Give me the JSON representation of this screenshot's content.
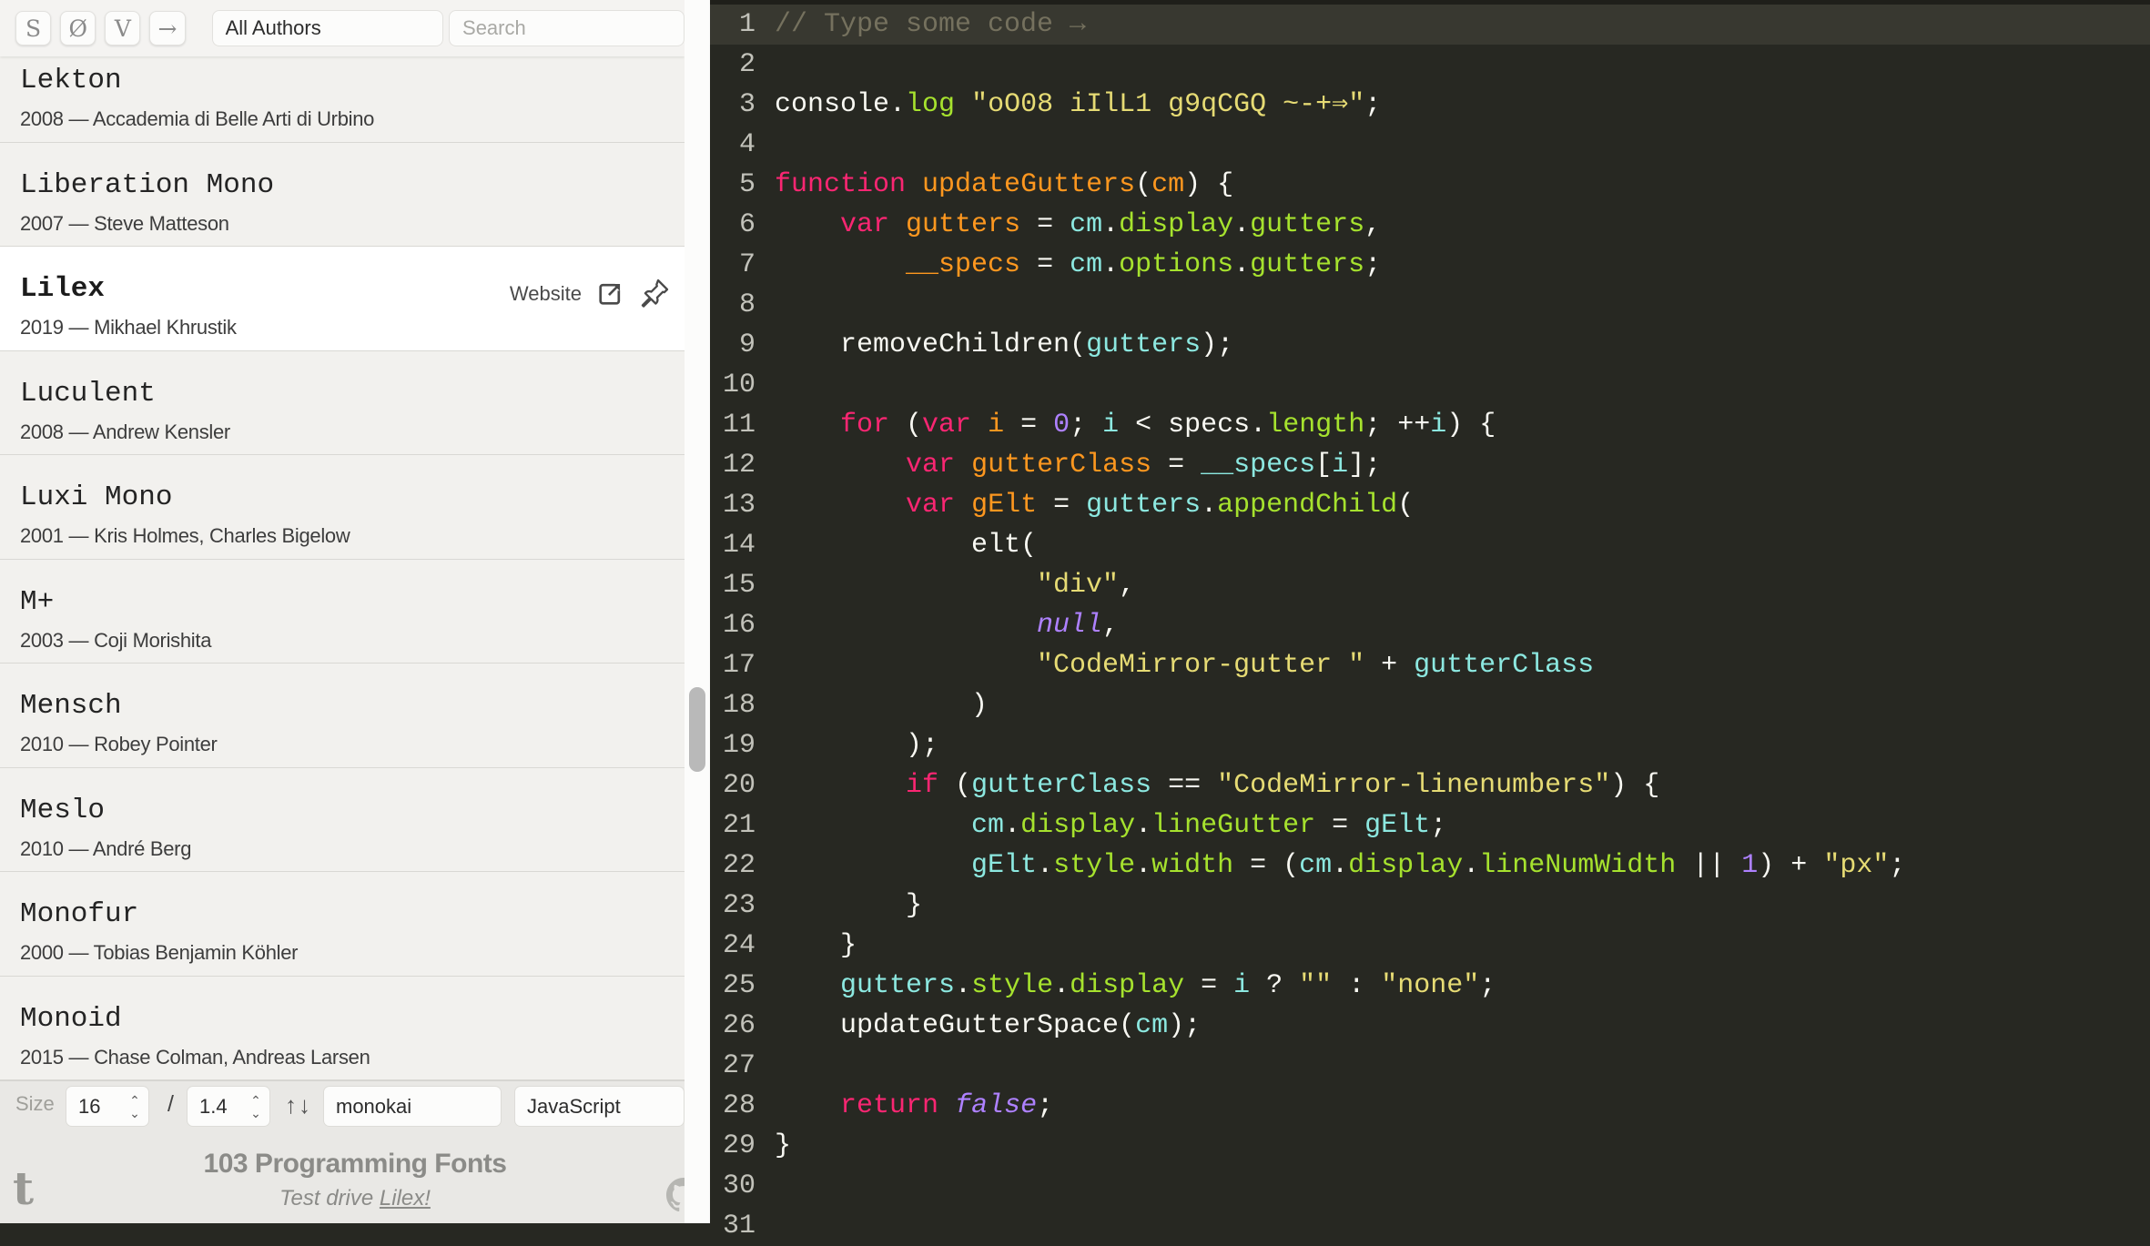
{
  "toolbar": {
    "buttons": [
      {
        "label": "S"
      },
      {
        "label": "Ø"
      },
      {
        "label": "V"
      },
      {
        "label": "→"
      }
    ],
    "author_filter": "All Authors",
    "search_placeholder": "Search"
  },
  "font_list": [
    {
      "name": "Lekton",
      "year": "2008",
      "author": "Accademia di Belle Arti di Urbino",
      "selected": false
    },
    {
      "name": "Liberation Mono",
      "year": "2007",
      "author": "Steve Matteson",
      "selected": false
    },
    {
      "name": "Lilex",
      "year": "2019",
      "author": "Mikhael Khrustik",
      "selected": true,
      "website_label": "Website"
    },
    {
      "name": "Luculent",
      "year": "2008",
      "author": "Andrew Kensler",
      "selected": false
    },
    {
      "name": "Luxi Mono",
      "year": "2001",
      "author": "Kris Holmes, Charles Bigelow",
      "selected": false
    },
    {
      "name": "M+",
      "year": "2003",
      "author": "Coji Morishita",
      "selected": false
    },
    {
      "name": "Mensch",
      "year": "2010",
      "author": "Robey Pointer",
      "selected": false
    },
    {
      "name": "Meslo",
      "year": "2010",
      "author": "André Berg",
      "selected": false
    },
    {
      "name": "Monofur",
      "year": "2000",
      "author": "Tobias Benjamin Köhler",
      "selected": false
    },
    {
      "name": "Monoid",
      "year": "2015",
      "author": "Chase Colman, Andreas Larsen",
      "selected": false
    }
  ],
  "list_separator": " — ",
  "controls": {
    "size_label": "Size",
    "size_value": "16",
    "separator": "/",
    "line_height_value": "1.4",
    "theme_up": "↑",
    "theme_down": "↓",
    "theme": "monokai",
    "language": "JavaScript"
  },
  "footer": {
    "title": "103 Programming Fonts",
    "tagline_prefix": "Test drive ",
    "tagline_link": "Lilex!"
  },
  "editor": {
    "theme_name": "monokai",
    "palette": {
      "background": "#272822",
      "active_line": "#383830",
      "gutter_text": "#c2c2ba",
      "t": "#f8f8f2",
      "c": "#75715e",
      "k": "#f92672",
      "d": "#fd971f",
      "v": "#8ce8e0",
      "p": "#a6e22e",
      "s": "#e6db74",
      "a": "#ae81ff",
      "n": "#ae81ff"
    },
    "lines": [
      {
        "n": 1,
        "active": true,
        "tokens": [
          [
            "c",
            "// Type some code →"
          ]
        ]
      },
      {
        "n": 2,
        "tokens": []
      },
      {
        "n": 3,
        "tokens": [
          [
            "t",
            "console."
          ],
          [
            "p",
            "log"
          ],
          [
            "t",
            " "
          ],
          [
            "s",
            "\"oO08 iIlL1 g9qCGQ ~-+⇒\""
          ],
          [
            "t",
            ";"
          ]
        ]
      },
      {
        "n": 4,
        "tokens": []
      },
      {
        "n": 5,
        "tokens": [
          [
            "k",
            "function"
          ],
          [
            "t",
            " "
          ],
          [
            "d",
            "updateGutters"
          ],
          [
            "t",
            "("
          ],
          [
            "d",
            "cm"
          ],
          [
            "t",
            ") {"
          ]
        ]
      },
      {
        "n": 6,
        "tokens": [
          [
            "t",
            "    "
          ],
          [
            "k",
            "var"
          ],
          [
            "t",
            " "
          ],
          [
            "d",
            "gutters"
          ],
          [
            "t",
            " = "
          ],
          [
            "v",
            "cm"
          ],
          [
            "t",
            "."
          ],
          [
            "p",
            "display"
          ],
          [
            "t",
            "."
          ],
          [
            "p",
            "gutters"
          ],
          [
            "t",
            ","
          ]
        ]
      },
      {
        "n": 7,
        "tokens": [
          [
            "t",
            "        "
          ],
          [
            "d",
            "__specs"
          ],
          [
            "t",
            " = "
          ],
          [
            "v",
            "cm"
          ],
          [
            "t",
            "."
          ],
          [
            "p",
            "options"
          ],
          [
            "t",
            "."
          ],
          [
            "p",
            "gutters"
          ],
          [
            "t",
            ";"
          ]
        ]
      },
      {
        "n": 8,
        "tokens": []
      },
      {
        "n": 9,
        "tokens": [
          [
            "t",
            "    removeChildren("
          ],
          [
            "v",
            "gutters"
          ],
          [
            "t",
            ");"
          ]
        ]
      },
      {
        "n": 10,
        "tokens": []
      },
      {
        "n": 11,
        "tokens": [
          [
            "t",
            "    "
          ],
          [
            "k",
            "for"
          ],
          [
            "t",
            " ("
          ],
          [
            "k",
            "var"
          ],
          [
            "t",
            " "
          ],
          [
            "d",
            "i"
          ],
          [
            "t",
            " = "
          ],
          [
            "n",
            "0"
          ],
          [
            "t",
            "; "
          ],
          [
            "v",
            "i"
          ],
          [
            "t",
            " < specs."
          ],
          [
            "p",
            "length"
          ],
          [
            "t",
            "; ++"
          ],
          [
            "v",
            "i"
          ],
          [
            "t",
            ") {"
          ]
        ]
      },
      {
        "n": 12,
        "tokens": [
          [
            "t",
            "        "
          ],
          [
            "k",
            "var"
          ],
          [
            "t",
            " "
          ],
          [
            "d",
            "gutterClass"
          ],
          [
            "t",
            " = "
          ],
          [
            "v",
            "__specs"
          ],
          [
            "t",
            "["
          ],
          [
            "v",
            "i"
          ],
          [
            "t",
            "];"
          ]
        ]
      },
      {
        "n": 13,
        "tokens": [
          [
            "t",
            "        "
          ],
          [
            "k",
            "var"
          ],
          [
            "t",
            " "
          ],
          [
            "d",
            "gElt"
          ],
          [
            "t",
            " = "
          ],
          [
            "v",
            "gutters"
          ],
          [
            "t",
            "."
          ],
          [
            "p",
            "appendChild"
          ],
          [
            "t",
            "("
          ]
        ]
      },
      {
        "n": 14,
        "tokens": [
          [
            "t",
            "            elt("
          ]
        ]
      },
      {
        "n": 15,
        "tokens": [
          [
            "t",
            "                "
          ],
          [
            "s",
            "\"div\""
          ],
          [
            "t",
            ","
          ]
        ]
      },
      {
        "n": 16,
        "tokens": [
          [
            "t",
            "                "
          ],
          [
            "a",
            "null"
          ],
          [
            "t",
            ","
          ]
        ]
      },
      {
        "n": 17,
        "tokens": [
          [
            "t",
            "                "
          ],
          [
            "s",
            "\"CodeMirror-gutter \""
          ],
          [
            "t",
            " + "
          ],
          [
            "v",
            "gutterClass"
          ]
        ]
      },
      {
        "n": 18,
        "tokens": [
          [
            "t",
            "            )"
          ]
        ]
      },
      {
        "n": 19,
        "tokens": [
          [
            "t",
            "        );"
          ]
        ]
      },
      {
        "n": 20,
        "tokens": [
          [
            "t",
            "        "
          ],
          [
            "k",
            "if"
          ],
          [
            "t",
            " ("
          ],
          [
            "v",
            "gutterClass"
          ],
          [
            "t",
            " == "
          ],
          [
            "s",
            "\"CodeMirror-linenumbers\""
          ],
          [
            "t",
            ") {"
          ]
        ]
      },
      {
        "n": 21,
        "tokens": [
          [
            "t",
            "            "
          ],
          [
            "v",
            "cm"
          ],
          [
            "t",
            "."
          ],
          [
            "p",
            "display"
          ],
          [
            "t",
            "."
          ],
          [
            "p",
            "lineGutter"
          ],
          [
            "t",
            " = "
          ],
          [
            "v",
            "gElt"
          ],
          [
            "t",
            ";"
          ]
        ]
      },
      {
        "n": 22,
        "tokens": [
          [
            "t",
            "            "
          ],
          [
            "v",
            "gElt"
          ],
          [
            "t",
            "."
          ],
          [
            "p",
            "style"
          ],
          [
            "t",
            "."
          ],
          [
            "p",
            "width"
          ],
          [
            "t",
            " = ("
          ],
          [
            "v",
            "cm"
          ],
          [
            "t",
            "."
          ],
          [
            "p",
            "display"
          ],
          [
            "t",
            "."
          ],
          [
            "p",
            "lineNumWidth"
          ],
          [
            "t",
            " || "
          ],
          [
            "n",
            "1"
          ],
          [
            "t",
            ") + "
          ],
          [
            "s",
            "\"px\""
          ],
          [
            "t",
            ";"
          ]
        ]
      },
      {
        "n": 23,
        "tokens": [
          [
            "t",
            "        }"
          ]
        ]
      },
      {
        "n": 24,
        "tokens": [
          [
            "t",
            "    }"
          ]
        ]
      },
      {
        "n": 25,
        "tokens": [
          [
            "t",
            "    "
          ],
          [
            "v",
            "gutters"
          ],
          [
            "t",
            "."
          ],
          [
            "p",
            "style"
          ],
          [
            "t",
            "."
          ],
          [
            "p",
            "display"
          ],
          [
            "t",
            " = "
          ],
          [
            "v",
            "i"
          ],
          [
            "t",
            " ? "
          ],
          [
            "s",
            "\"\""
          ],
          [
            "t",
            " : "
          ],
          [
            "s",
            "\"none\""
          ],
          [
            "t",
            ";"
          ]
        ]
      },
      {
        "n": 26,
        "tokens": [
          [
            "t",
            "    updateGutterSpace("
          ],
          [
            "v",
            "cm"
          ],
          [
            "t",
            ");"
          ]
        ]
      },
      {
        "n": 27,
        "tokens": []
      },
      {
        "n": 28,
        "tokens": [
          [
            "t",
            "    "
          ],
          [
            "k",
            "return"
          ],
          [
            "t",
            " "
          ],
          [
            "a",
            "false"
          ],
          [
            "t",
            ";"
          ]
        ]
      },
      {
        "n": 29,
        "tokens": [
          [
            "t",
            "}"
          ]
        ]
      },
      {
        "n": 30,
        "tokens": []
      },
      {
        "n": 31,
        "tokens": []
      }
    ]
  }
}
